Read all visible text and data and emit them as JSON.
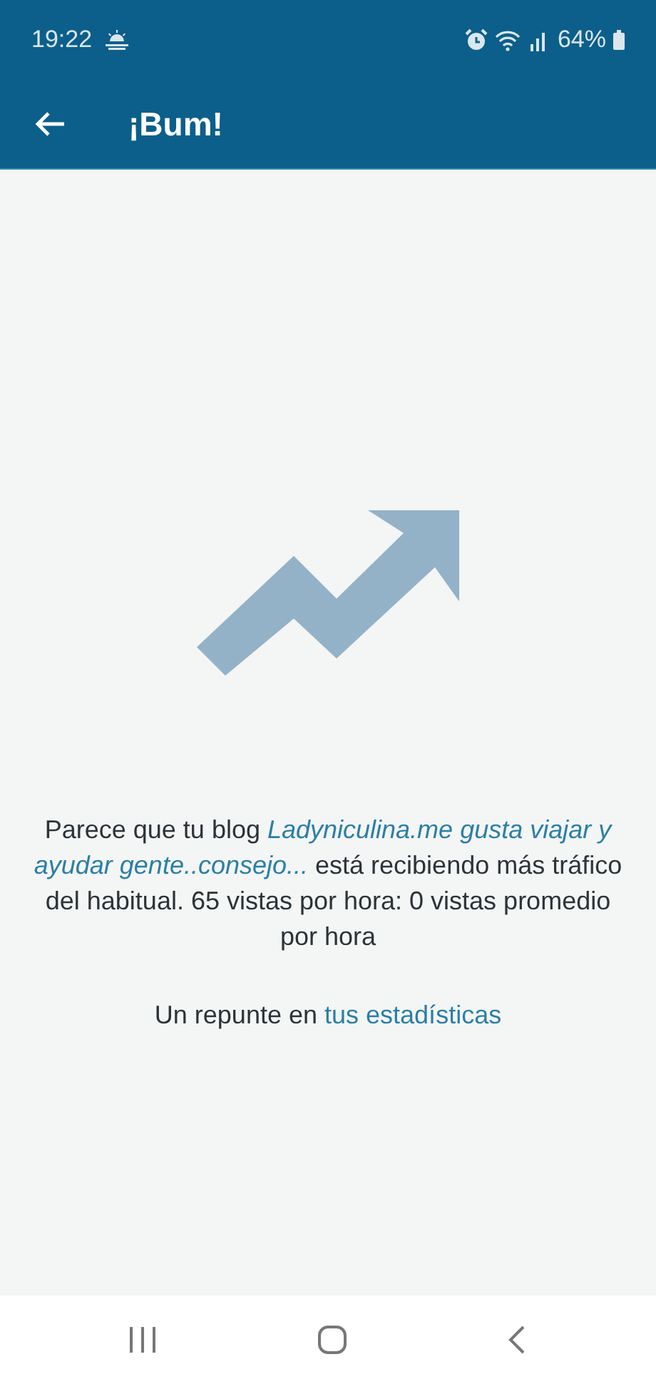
{
  "status_bar": {
    "time": "19:22",
    "battery": "64%"
  },
  "app_bar": {
    "title": "¡Bum!"
  },
  "message": {
    "text": "Parece que tu blog *Ladyniculina.me gusta viajar y ayudar gente..consejo...* está recibiendo más tráfico del habitual. 65 vistas por hora: 0 vistas promedio por hora"
  },
  "stats_line": {
    "text": "Un repunte en",
    "link": "tus estadísticas"
  }
}
